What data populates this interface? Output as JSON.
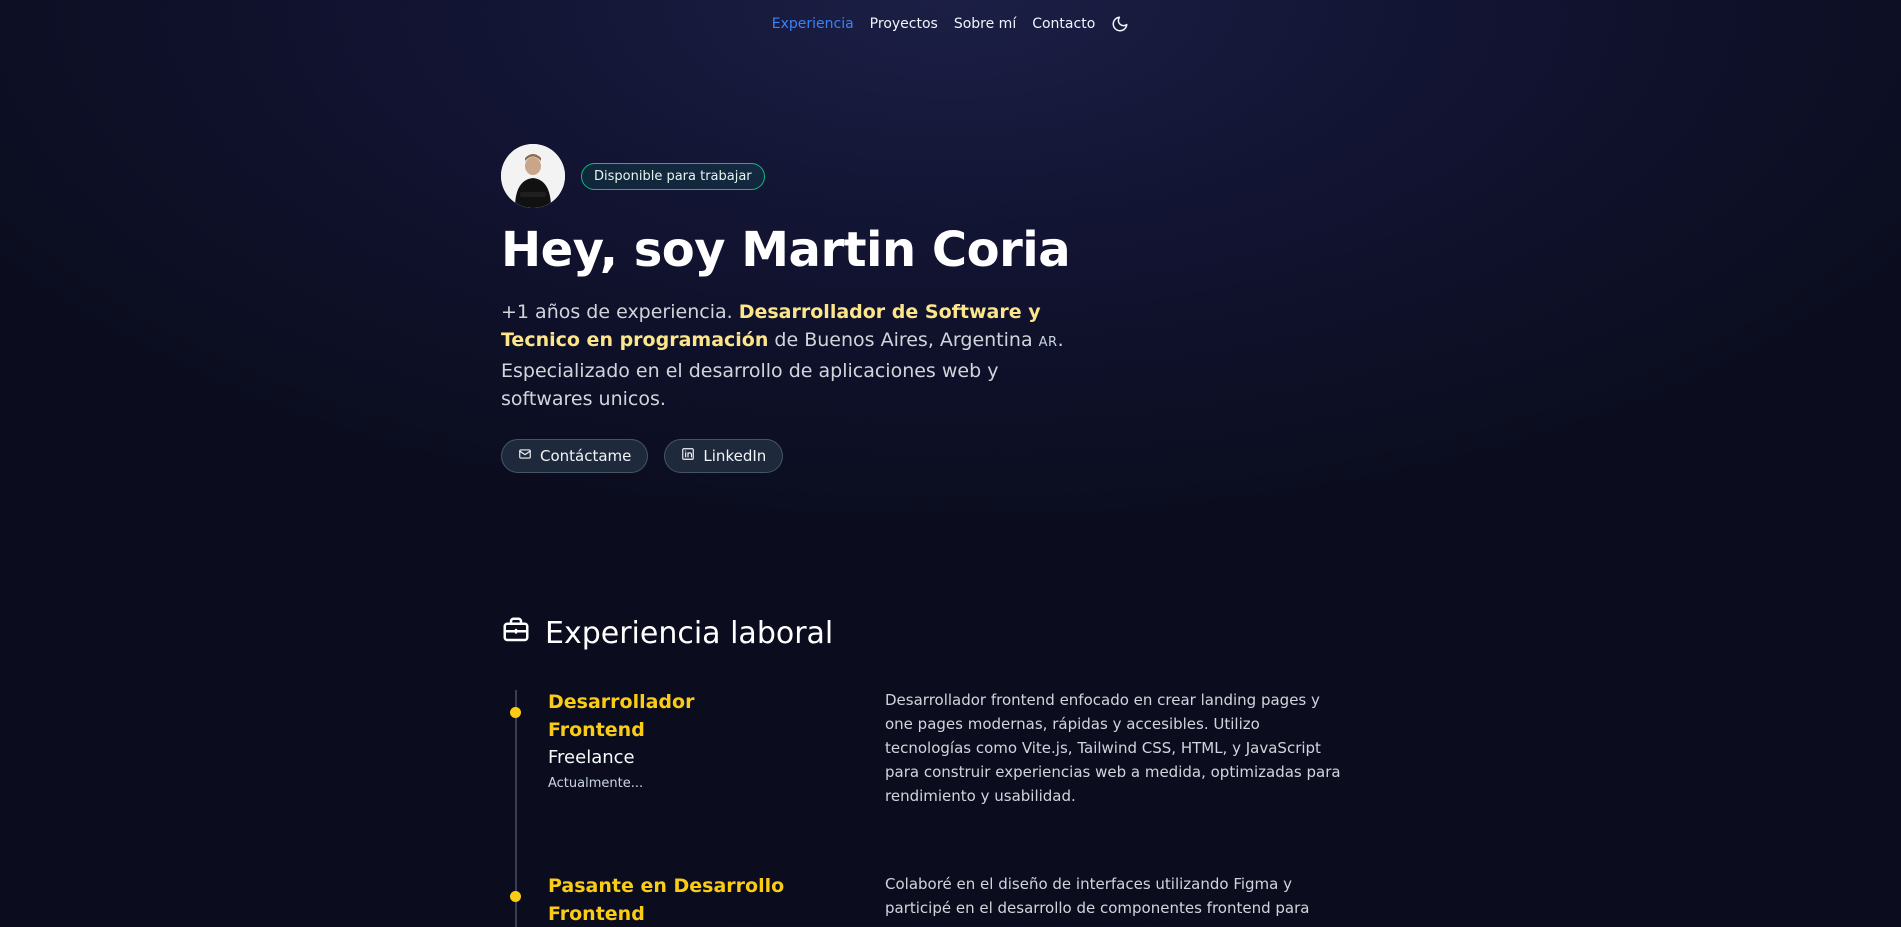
{
  "nav": {
    "items": [
      {
        "label": "Experiencia",
        "active": true
      },
      {
        "label": "Proyectos",
        "active": false
      },
      {
        "label": "Sobre mí",
        "active": false
      },
      {
        "label": "Contacto",
        "active": false
      }
    ],
    "theme_icon": "moon-icon"
  },
  "hero": {
    "badge": "Disponible para trabajar",
    "title": "Hey, soy Martin Coria",
    "intro_part1": "+1 años de experiencia. ",
    "intro_highlight": "Desarrollador de Software y Tecnico en programación",
    "intro_part2": " de Buenos Aires, Argentina ",
    "intro_flag": "AR",
    "intro_part3": ". Especializado en el desarrollo de aplicaciones web y softwares unicos.",
    "buttons": [
      {
        "label": "Contáctame",
        "icon": "mail-icon"
      },
      {
        "label": "LinkedIn",
        "icon": "linkedin-icon"
      }
    ]
  },
  "experience": {
    "title": "Experiencia laboral",
    "icon": "briefcase-icon",
    "jobs": [
      {
        "title": "Desarrollador Frontend",
        "company": "Freelance",
        "date": "Actualmente...",
        "description": "Desarrollador frontend enfocado en crear landing pages y one pages modernas, rápidas y accesibles. Utilizo tecnologías como Vite.js, Tailwind CSS, HTML, y JavaScript para construir experiencias web a medida, optimizadas para rendimiento y usabilidad."
      },
      {
        "title": "Pasante en Desarrollo Frontend",
        "description": "Colaboré en el diseño de interfaces utilizando Figma y participé en el desarrollo de componentes frontend para"
      }
    ]
  },
  "colors": {
    "accent_blue": "#3b82f6",
    "highlight_yellow": "#facc15",
    "badge_green": "#10b981"
  }
}
